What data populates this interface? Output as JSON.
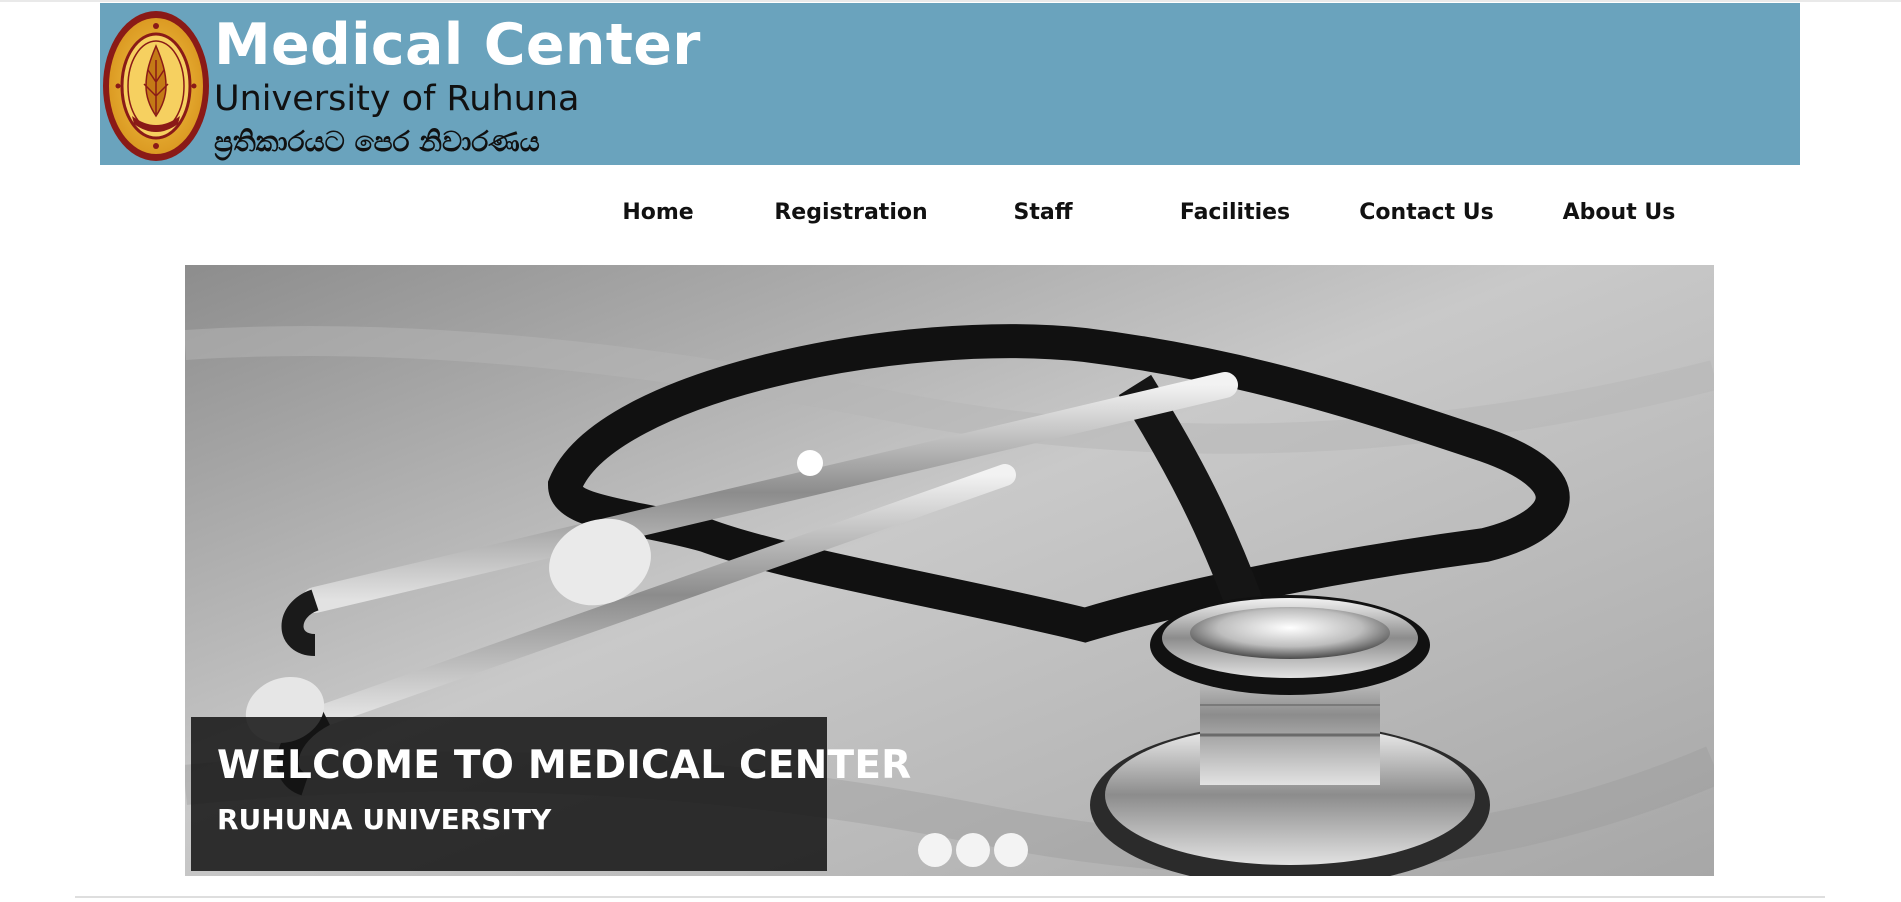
{
  "header": {
    "title": "Medical Center",
    "subtitle": "University of Ruhuna",
    "motto": "ප්‍රතිකාරයට පෙර නිවාරණය",
    "background_color": "#6aa3bd",
    "logo_icon": "university-of-ruhuna-crest-icon"
  },
  "nav": {
    "items": [
      {
        "label": "Home"
      },
      {
        "label": "Registration"
      },
      {
        "label": "Staff"
      },
      {
        "label": "Facilities"
      },
      {
        "label": "Contact Us"
      },
      {
        "label": "About Us"
      }
    ]
  },
  "hero": {
    "image_icon": "stethoscope-photo",
    "caption_title": "WELCOME TO MEDICAL CENTER",
    "caption_subtitle": "RUHUNA UNIVERSITY",
    "slide_count": 3
  }
}
